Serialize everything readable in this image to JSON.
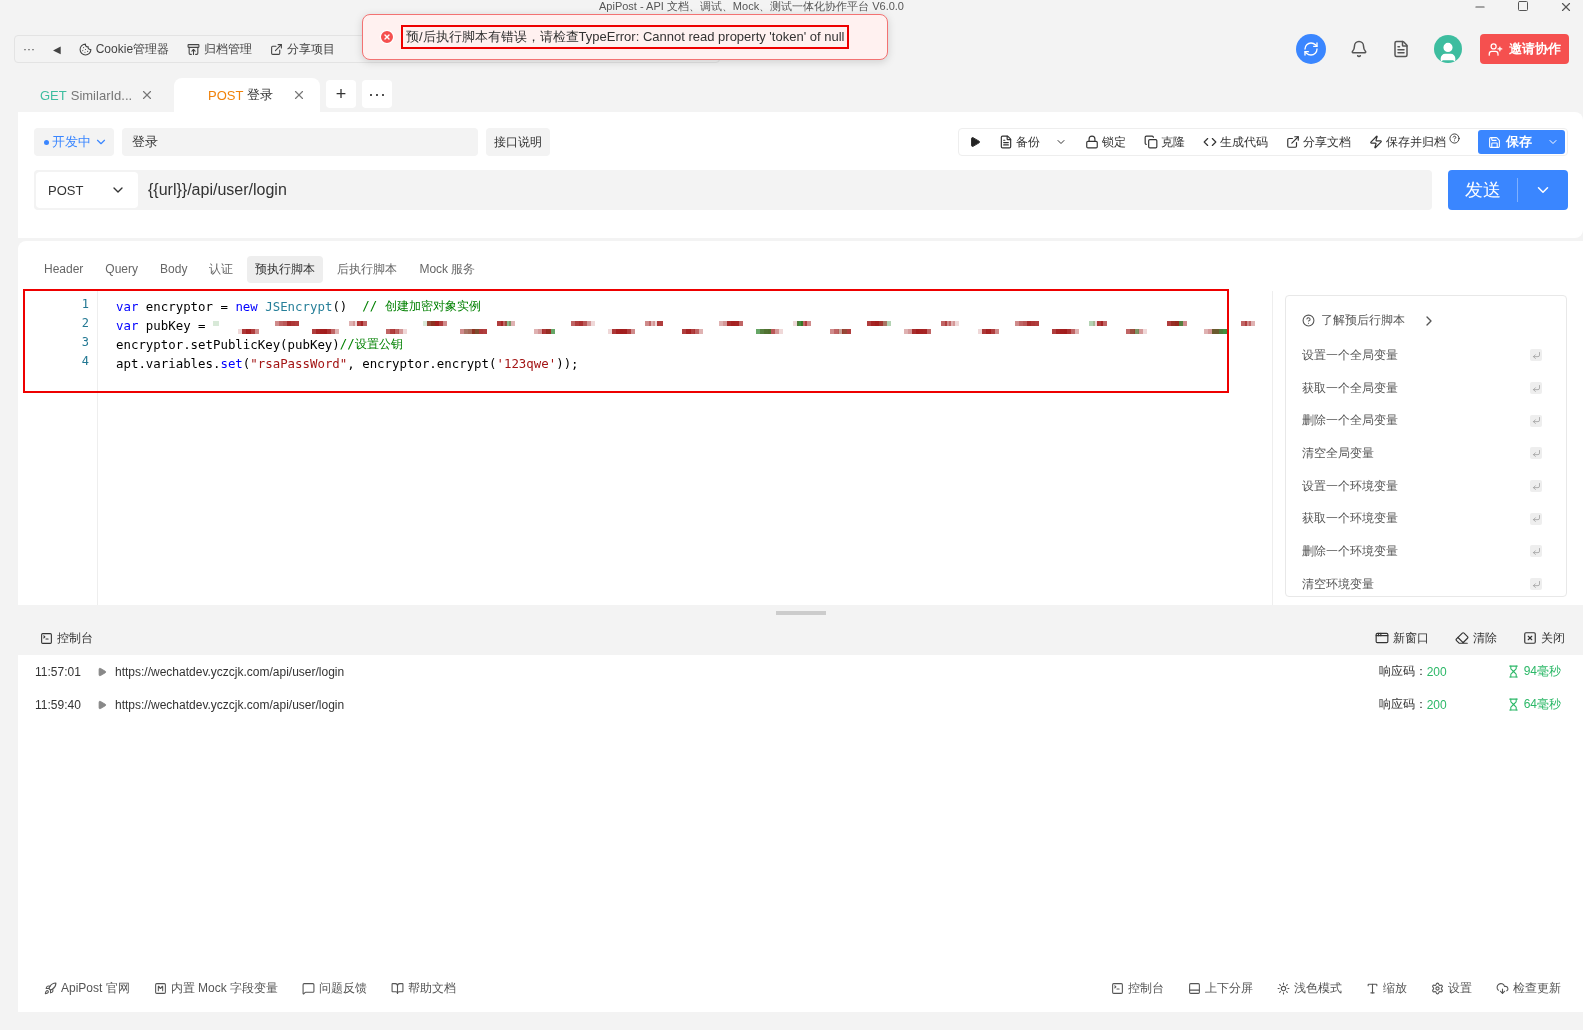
{
  "window": {
    "title": "ApiPost - API 文档、调试、Mock、测试一体化协作平台 V6.0.0"
  },
  "toolbar": {
    "more": "···",
    "back": "◀",
    "items": [
      {
        "kind": "cookie",
        "label": "Cookie管理器"
      },
      {
        "kind": "archive",
        "label": "归档管理"
      },
      {
        "kind": "share",
        "label": "分享项目"
      }
    ]
  },
  "toast": {
    "message": "预/后执行脚本有错误，请检查TypeError: Cannot read property 'token' of null",
    "highlighted": true
  },
  "invite_button": "邀请协作",
  "tabs": [
    {
      "method": "GET",
      "name": "SimilarId...",
      "selected": false
    },
    {
      "method": "POST",
      "name": "登录",
      "selected": true
    }
  ],
  "tab_add": "+",
  "tab_more": "···",
  "request": {
    "status": "开发中",
    "name": "登录",
    "doc_button": "接口说明",
    "actions": [
      {
        "kind": "backup",
        "label": "备份",
        "caret": true
      },
      {
        "kind": "lock",
        "label": "锁定",
        "caret": false
      },
      {
        "kind": "clone",
        "label": "克隆",
        "caret": false
      },
      {
        "kind": "code",
        "label": "生成代码",
        "caret": false
      },
      {
        "kind": "share",
        "label": "分享文档",
        "caret": false
      },
      {
        "kind": "archive",
        "label": "保存并归档",
        "caret": false
      }
    ],
    "save": "保存",
    "method": "POST",
    "url": "{{url}}/api/user/login",
    "send": "发送"
  },
  "request_tabs": [
    {
      "label": "Header",
      "selected": false
    },
    {
      "label": "Query",
      "selected": false
    },
    {
      "label": "Body",
      "selected": false
    },
    {
      "label": "认证",
      "selected": false
    },
    {
      "label": "预执行脚本",
      "selected": true
    },
    {
      "label": "后执行脚本",
      "selected": false
    },
    {
      "label": "Mock 服务",
      "selected": false
    }
  ],
  "code": {
    "highlighted": true,
    "lines": [
      {
        "number": "1",
        "tokens": [
          {
            "kind": "keyword",
            "text": "var"
          },
          {
            "kind": "plain",
            "text": " encryptor = "
          },
          {
            "kind": "keyword",
            "text": "new"
          },
          {
            "kind": "type",
            "text": " JSEncrypt"
          },
          {
            "kind": "plain",
            "text": "()  "
          },
          {
            "kind": "comment",
            "text": "// 创建加密对象实例"
          }
        ]
      },
      {
        "number": "2",
        "tokens": [
          {
            "kind": "keyword",
            "text": "var"
          },
          {
            "kind": "plain",
            "text": " pubKey = "
          },
          {
            "kind": "redacted"
          }
        ]
      },
      {
        "number": "3",
        "tokens": [
          {
            "kind": "plain",
            "text": "encryptor.setPublicKey(pubKey)"
          },
          {
            "kind": "comment",
            "text": "//设置公钥"
          }
        ]
      },
      {
        "number": "4",
        "tokens": [
          {
            "kind": "plain",
            "text": "apt.variables."
          },
          {
            "kind": "keyword",
            "text": "set"
          },
          {
            "kind": "plain",
            "text": "("
          },
          {
            "kind": "string",
            "text": "\"rsaPassWord\""
          },
          {
            "kind": "plain",
            "text": ", encryptor.encrypt("
          },
          {
            "kind": "string",
            "text": "'123qwe'"
          },
          {
            "kind": "plain",
            "text": "));"
          }
        ]
      }
    ]
  },
  "snippets": {
    "title": "了解预后行脚本",
    "items": [
      "设置一个全局变量",
      "获取一个全局变量",
      "删除一个全局变量",
      "清空全局变量",
      "设置一个环境变量",
      "获取一个环境变量",
      "删除一个环境变量",
      "清空环境变量"
    ]
  },
  "console": {
    "title": "控制台",
    "actions": [
      {
        "kind": "window",
        "label": "新窗口"
      },
      {
        "kind": "clear",
        "label": "清除"
      },
      {
        "kind": "close",
        "label": "关闭"
      }
    ],
    "logs": [
      {
        "time": "11:57:01",
        "url": "https://wechatdev.yczcjk.com/api/user/login",
        "code_label": "响应码：",
        "code": "200",
        "duration": "94毫秒"
      },
      {
        "time": "11:59:40",
        "url": "https://wechatdev.yczcjk.com/api/user/login",
        "code_label": "响应码：",
        "code": "200",
        "duration": "64毫秒"
      }
    ]
  },
  "footer": {
    "left": [
      {
        "kind": "rocket",
        "label": "ApiPost 官网"
      },
      {
        "kind": "mock",
        "label": "内置 Mock 字段变量"
      },
      {
        "kind": "feedback",
        "label": "问题反馈"
      },
      {
        "kind": "docs",
        "label": "帮助文档"
      }
    ],
    "right": [
      {
        "kind": "console",
        "label": "控制台"
      },
      {
        "kind": "split",
        "label": "上下分屏"
      },
      {
        "kind": "sun",
        "label": "浅色模式"
      },
      {
        "kind": "font",
        "label": "缩放"
      },
      {
        "kind": "settings",
        "label": "设置"
      },
      {
        "kind": "update",
        "label": "检查更新"
      }
    ]
  }
}
